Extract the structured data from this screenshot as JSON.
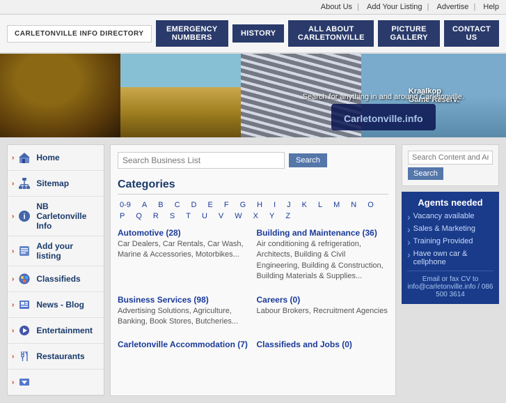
{
  "topbar": {
    "links": [
      "About Us",
      "Add Your Listing",
      "Advertise",
      "Help"
    ],
    "separator": "|"
  },
  "navbar": {
    "logo": "CARLETONVILLE INFO DIRECTORY",
    "buttons": [
      "EMERGENCY NUMBERS",
      "HISTORY",
      "ALL ABOUT CARLETONVILLE",
      "PICTURE GALLERY",
      "CONTACT US"
    ]
  },
  "banner": {
    "search_text": "Search for anything in and around Carletonville.",
    "logo_main": "Carletonville",
    "logo_suffix": ".info",
    "sign_text": "Kraalkop Game Reserv..."
  },
  "sidebar": {
    "items": [
      {
        "label": "Home",
        "icon": "home"
      },
      {
        "label": "Sitemap",
        "icon": "sitemap"
      },
      {
        "label": "NB Carletonville Info",
        "icon": "info"
      },
      {
        "label": "Add your listing",
        "icon": "add"
      },
      {
        "label": "Classifieds",
        "icon": "classifieds"
      },
      {
        "label": "News - Blog",
        "icon": "news"
      },
      {
        "label": "Entertainment",
        "icon": "entertainment"
      },
      {
        "label": "Restaurants",
        "icon": "restaurants"
      },
      {
        "label": "",
        "icon": "bottom"
      }
    ]
  },
  "main": {
    "search_placeholder": "Search Business List",
    "search_btn": "Search",
    "categories_title": "Categories",
    "alpha": [
      "0-9",
      "A",
      "B",
      "C",
      "D",
      "E",
      "F",
      "G",
      "H",
      "I",
      "J",
      "K",
      "L",
      "M",
      "N",
      "O",
      "P",
      "Q",
      "R",
      "S",
      "T",
      "U",
      "V",
      "W",
      "X",
      "Y",
      "Z"
    ],
    "categories": [
      {
        "name": "Automotive",
        "count": "(28)",
        "desc": "Car Dealers, Car Rentals, Car Wash, Marine & Accessories, Motorbikes..."
      },
      {
        "name": "Building and Maintenance",
        "count": "(36)",
        "desc": "Air conditioning & refrigeration, Architects, Building & Civil Engineering, Building & Construction, Building Materials & Supplies..."
      },
      {
        "name": "Business Services",
        "count": "(98)",
        "desc": "Advertising Solutions, Agriculture, Banking, Book Stores, Butcheries..."
      },
      {
        "name": "Careers",
        "count": "(0)",
        "desc": "Labour Brokers, Recruitment Agencies"
      },
      {
        "name": "Carletonville Accommodation",
        "count": "(7)",
        "desc": ""
      },
      {
        "name": "Classifieds and Jobs",
        "count": "(0)",
        "desc": ""
      }
    ]
  },
  "right": {
    "search_placeholder": "Search Content and Articles",
    "search_btn": "Search",
    "agents": {
      "title": "Agents needed",
      "items": [
        "Vacancy available",
        "Sales & Marketing",
        "Training Provided",
        "Have own car & cellphone"
      ],
      "contact": "Email or fax CV to\ninfo@carletonville.info\n/ 086 500 3614"
    }
  }
}
